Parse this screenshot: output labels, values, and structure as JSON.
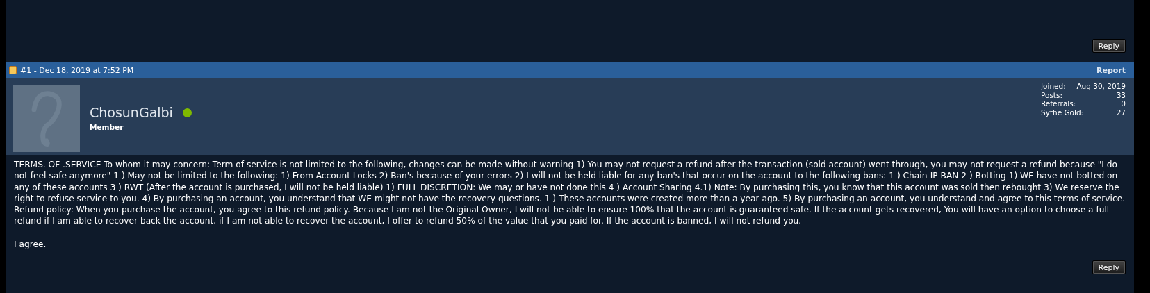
{
  "top_reply_button": "Reply",
  "post": {
    "header": {
      "number_date": "#1 - Dec 18, 2019 at 7:52 PM",
      "report_link": "Report"
    },
    "author": {
      "username": "ChosunGalbi",
      "online": true,
      "rank": "Member",
      "stats": [
        {
          "label": "Joined:",
          "value": "Aug 30, 2019"
        },
        {
          "label": "Posts:",
          "value": "33"
        },
        {
          "label": "Referrals:",
          "value": "0"
        },
        {
          "label": "Sythe Gold:",
          "value": "27"
        }
      ]
    },
    "body": [
      "TERMS. OF .SERVICE To whom it may concern: Term of service is not limited to the following, changes can be made without warning 1) You may not request a refund after the transaction (sold account) went through, you may not request a refund because \"I do not feel safe anymore\" 1 ) May not be limited to the following: 1) From Account Locks 2) Ban's because of your errors 2) I will not be held liable for any ban's that occur on the account to the following bans: 1 ) Chain-IP BAN 2 ) Botting 1) WE have not botted on any of these accounts 3 ) RWT (After the account is purchased, I will not be held liable) 1) FULL DISCRETION: We may or have not done this 4 ) Account Sharing 4.1) Note: By purchasing this, you know that this account was sold then rebought 3) We reserve the right to refuse service to you. 4) By purchasing an account, you understand that WE might not have the recovery questions. 1 ) These accounts were created more than a year ago. 5) By purchasing an account, you understand and agree to this terms of service. Refund policy: When you purchase the account, you agree to this refund policy. Because I am not the Original Owner, I will not be able to ensure 100% that the account is guaranteed safe. If the account gets recovered, You will have an option to choose a full-refund if I am able to recover back the account, if I am not able to recover the account, I offer to refund 50% of the value that you paid for. If the account is banned, I will not refund you.",
      "I agree."
    ],
    "reply_button": "Reply"
  }
}
